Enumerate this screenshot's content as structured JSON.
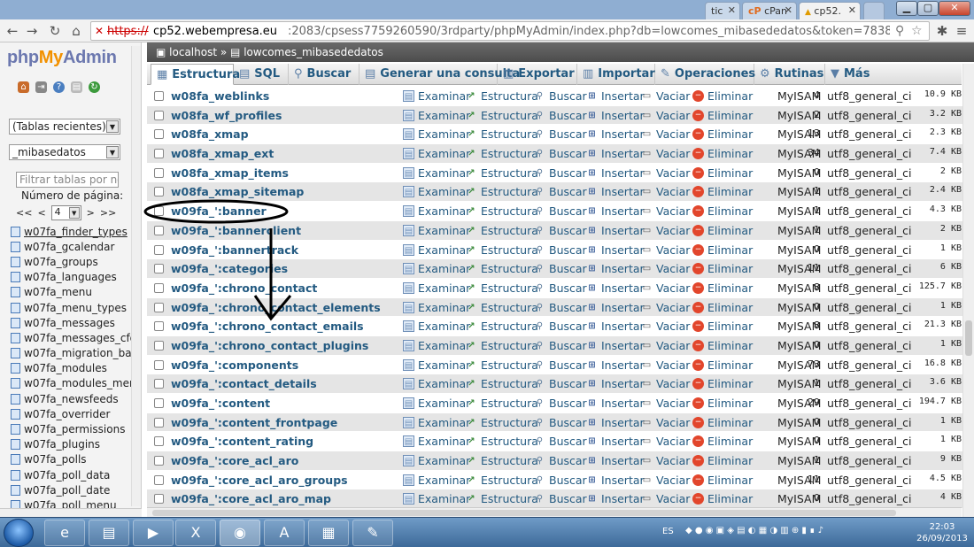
{
  "browser": {
    "tabs": [
      {
        "label": "tic",
        "active": false
      },
      {
        "label": "cPan",
        "active": false
      },
      {
        "label": "cp52.",
        "active": true
      }
    ],
    "url_protocol": "https://",
    "url_host": "cp52.webempresa.eu",
    "url_rest": ":2083/cpsess7759260590/3rdparty/phpMyAdmin/index.php?db=lowcomes_mibasededatos&token=783863ac41cd43bdae306fd2"
  },
  "sidebar": {
    "logo_php": "php",
    "logo_my": "My",
    "logo_admin": "Admin",
    "recent_select": "(Tablas recientes) ...",
    "db_select": "_mibasedatos",
    "filter_placeholder": "Filtrar tablas por nom",
    "page_label": "Número de página:",
    "pager_first": "<<",
    "pager_prev": "<",
    "page_value": "4",
    "pager_next": ">",
    "pager_last": ">>",
    "tables": [
      "w07fa_finder_types",
      "w07fa_gcalendar",
      "w07fa_groups",
      "w07fa_languages",
      "w07fa_menu",
      "w07fa_menu_types",
      "w07fa_messages",
      "w07fa_messages_cfg",
      "w07fa_migration_backli",
      "w07fa_modules",
      "w07fa_modules_menu",
      "w07fa_newsfeeds",
      "w07fa_overrider",
      "w07fa_permissions",
      "w07fa_plugins",
      "w07fa_polls",
      "w07fa_poll_data",
      "w07fa_poll_date",
      "w07fa_poll_menu"
    ]
  },
  "main": {
    "breadcrumb_server": "localhost",
    "breadcrumb_sep": "»",
    "breadcrumb_db": "lowcomes_mibasededatos",
    "tabs": [
      {
        "label": "Estructura",
        "icon": "structure-icon",
        "active": true
      },
      {
        "label": "SQL",
        "icon": "sql-icon",
        "active": false
      },
      {
        "label": "Buscar",
        "icon": "search-icon",
        "active": false
      },
      {
        "label": "Generar una consulta",
        "icon": "query-icon",
        "active": false
      },
      {
        "label": "Exportar",
        "icon": "export-icon",
        "active": false
      },
      {
        "label": "Importar",
        "icon": "import-icon",
        "active": false
      },
      {
        "label": "Operaciones",
        "icon": "wrench-icon",
        "active": false
      },
      {
        "label": "Rutinas",
        "icon": "routines-icon",
        "active": false
      },
      {
        "label": "Más",
        "icon": "chevron-down-icon",
        "active": false
      }
    ],
    "actions": {
      "browse": "Examinar",
      "structure": "Estructura",
      "search": "Buscar",
      "insert": "Insertar",
      "empty": "Vaciar",
      "drop": "Eliminar"
    },
    "rows": [
      {
        "name": "w08fa_weblinks",
        "rows": "4",
        "engine": "MyISAM",
        "collation": "utf8_general_ci",
        "size": "10.9 KB"
      },
      {
        "name": "w08fa_wf_profiles",
        "rows": "2",
        "engine": "MyISAM",
        "collation": "utf8_general_ci",
        "size": "3.2 KB"
      },
      {
        "name": "w08fa_xmap",
        "rows": "13",
        "engine": "MyISAM",
        "collation": "utf8_general_ci",
        "size": "2.3 KB"
      },
      {
        "name": "w08fa_xmap_ext",
        "rows": "34",
        "engine": "MyISAM",
        "collation": "utf8_general_ci",
        "size": "7.4 KB"
      },
      {
        "name": "w08fa_xmap_items",
        "rows": "0",
        "engine": "MyISAM",
        "collation": "utf8_general_ci",
        "size": "2 KB"
      },
      {
        "name": "w08fa_xmap_sitemap",
        "rows": "1",
        "engine": "MyISAM",
        "collation": "utf8_general_ci",
        "size": "2.4 KB"
      },
      {
        "name": "w09fa_':banner",
        "rows": "1",
        "engine": "MyISAM",
        "collation": "utf8_general_ci",
        "size": "4.3 KB"
      },
      {
        "name": "w09fa_':bannerclient",
        "rows": "1",
        "engine": "MyISAM",
        "collation": "utf8_general_ci",
        "size": "2 KB"
      },
      {
        "name": "w09fa_':bannertrack",
        "rows": "0",
        "engine": "MyISAM",
        "collation": "utf8_general_ci",
        "size": "1 KB"
      },
      {
        "name": "w09fa_':categories",
        "rows": "11",
        "engine": "MyISAM",
        "collation": "utf8_general_ci",
        "size": "6 KB"
      },
      {
        "name": "w09fa_':chrono_contact",
        "rows": "8",
        "engine": "MyISAM",
        "collation": "utf8_general_ci",
        "size": "125.7 KB"
      },
      {
        "name": "w09fa_':chrono_contact_elements",
        "rows": "0",
        "engine": "MyISAM",
        "collation": "utf8_general_ci",
        "size": "1 KB"
      },
      {
        "name": "w09fa_':chrono_contact_emails",
        "rows": "8",
        "engine": "MyISAM",
        "collation": "utf8_general_ci",
        "size": "21.3 KB"
      },
      {
        "name": "w09fa_':chrono_contact_plugins",
        "rows": "0",
        "engine": "MyISAM",
        "collation": "utf8_general_ci",
        "size": "1 KB"
      },
      {
        "name": "w09fa_':components",
        "rows": "73",
        "engine": "MyISAM",
        "collation": "utf8_general_ci",
        "size": "16.8 KB"
      },
      {
        "name": "w09fa_':contact_details",
        "rows": "1",
        "engine": "MyISAM",
        "collation": "utf8_general_ci",
        "size": "3.6 KB"
      },
      {
        "name": "w09fa_':content",
        "rows": "29",
        "engine": "MyISAM",
        "collation": "utf8_general_ci",
        "size": "194.7 KB"
      },
      {
        "name": "w09fa_':content_frontpage",
        "rows": "0",
        "engine": "MyISAM",
        "collation": "utf8_general_ci",
        "size": "1 KB"
      },
      {
        "name": "w09fa_':content_rating",
        "rows": "0",
        "engine": "MyISAM",
        "collation": "utf8_general_ci",
        "size": "1 KB"
      },
      {
        "name": "w09fa_':core_acl_aro",
        "rows": "1",
        "engine": "MyISAM",
        "collation": "utf8_general_ci",
        "size": "9 KB"
      },
      {
        "name": "w09fa_':core_acl_aro_groups",
        "rows": "11",
        "engine": "MyISAM",
        "collation": "utf8_general_ci",
        "size": "4.5 KB"
      },
      {
        "name": "w09fa_':core_acl_aro_map",
        "rows": "0",
        "engine": "MyISAM",
        "collation": "utf8_general_ci",
        "size": "4 KB"
      }
    ]
  },
  "taskbar": {
    "lang": "ES",
    "time": "22:03",
    "date": "26/09/2013"
  }
}
